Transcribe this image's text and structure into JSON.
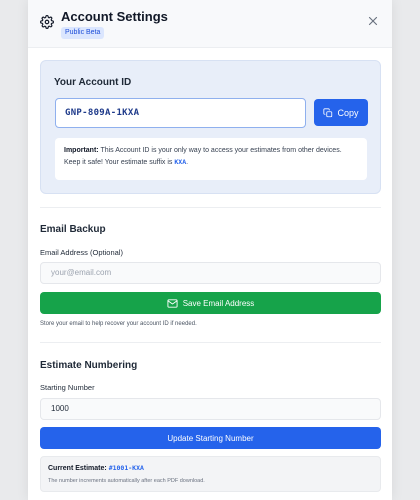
{
  "header": {
    "title": "Account Settings",
    "badge": "Public Beta",
    "icon": "gear-icon",
    "close_icon": "close-icon"
  },
  "account_id": {
    "title": "Your Account ID",
    "value": "GNP-809A-1KXA",
    "copy_label": "Copy",
    "important_label": "Important:",
    "important_text": "This Account ID is your only way to access your estimates from other devices. Keep it safe! Your estimate suffix is",
    "suffix": "KXA",
    "suffix_end": "."
  },
  "email_backup": {
    "title": "Email Backup",
    "field_label": "Email Address (Optional)",
    "placeholder": "your@email.com",
    "save_label": "Save Email Address",
    "hint": "Store your email to help recover your account ID if needed."
  },
  "numbering": {
    "title": "Estimate Numbering",
    "field_label": "Starting Number",
    "value": "1000",
    "update_label": "Update Starting Number",
    "current_label": "Current Estimate:",
    "current_code": "#1001-KXA",
    "current_note": "The number increments automatically after each PDF download."
  },
  "colors": {
    "primary": "#2563eb",
    "success": "#16a34a",
    "id_panel_bg": "#e8eef9",
    "badge_bg": "#dbe6fe"
  }
}
